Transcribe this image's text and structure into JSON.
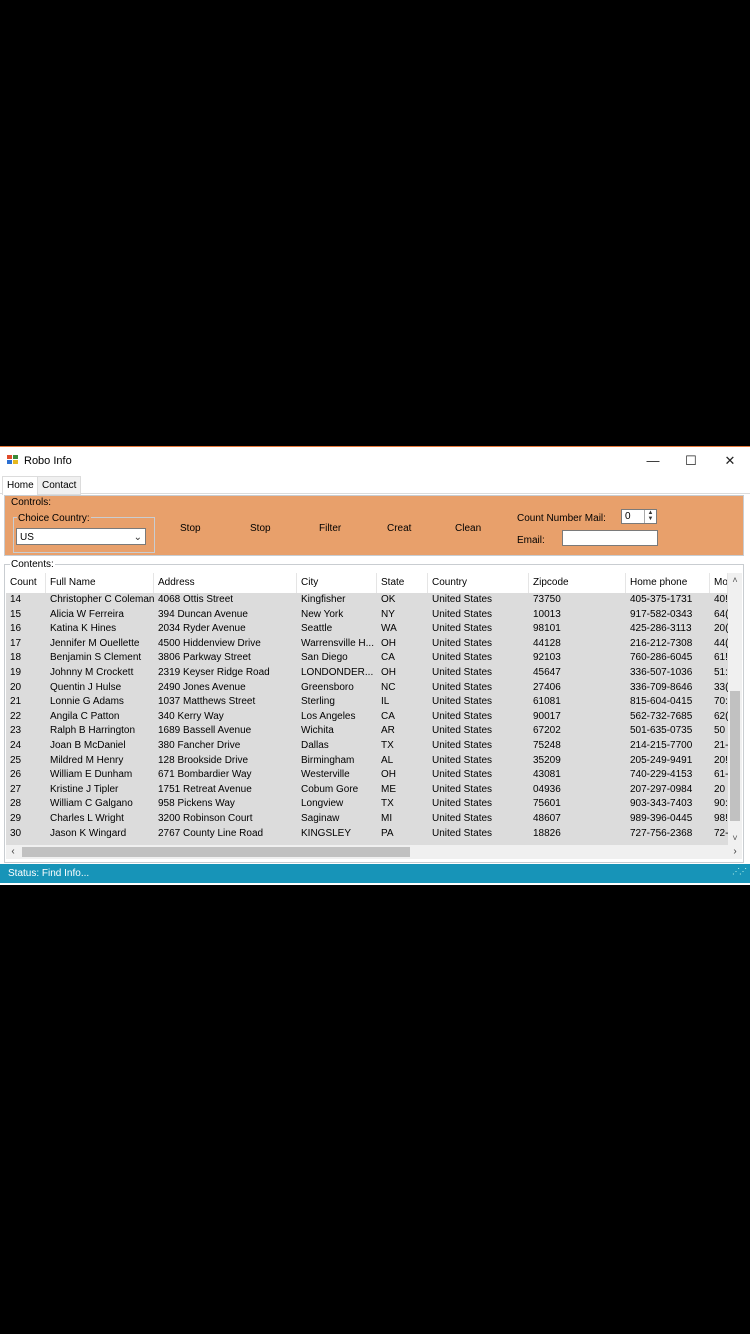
{
  "window": {
    "title": "Robo Info",
    "minimize": "—",
    "maximize": "☐",
    "close": "✕"
  },
  "tabs": {
    "home": "Home",
    "contact": "Contact"
  },
  "controls": {
    "group_label": "Controls:",
    "choice_label": "Choice Country:",
    "country_value": "US",
    "buttons": [
      "Stop",
      "Stop",
      "Filter",
      "Creat",
      "Clean"
    ],
    "count_label": "Count Number Mail:",
    "count_value": "0",
    "email_label": "Email:"
  },
  "contents": {
    "label": "Contents:",
    "columns": [
      "Count",
      "Full Name",
      "Address",
      "City",
      "State",
      "Country",
      "Zipcode",
      "Home phone",
      "Mo"
    ],
    "rows": [
      [
        "14",
        "Christopher C Coleman",
        "4068  Ottis Street",
        "Kingfisher",
        "OK",
        "United States",
        "73750",
        "405-375-1731",
        "40!"
      ],
      [
        "15",
        "Alicia W Ferreira",
        "394  Duncan Avenue",
        "New York",
        "NY",
        "United States",
        "10013",
        "917-582-0343",
        "64("
      ],
      [
        "16",
        "Katina K Hines",
        "2034  Ryder Avenue",
        "Seattle",
        "WA",
        "United States",
        "98101",
        "425-286-3113",
        "20("
      ],
      [
        "17",
        "Jennifer M Ouellette",
        "4500  Hiddenview Drive",
        "Warrensville H...",
        "OH",
        "United States",
        "44128",
        "216-212-7308",
        "44("
      ],
      [
        "18",
        "Benjamin S Clement",
        "3806  Parkway Street",
        "San Diego",
        "CA",
        "United States",
        "92103",
        "760-286-6045",
        "61!"
      ],
      [
        "19",
        "Johnny M Crockett",
        "2319  Keyser Ridge Road",
        "LONDONDER...",
        "OH",
        "United States",
        "45647",
        "336-507-1036",
        "51:"
      ],
      [
        "20",
        "Quentin J Hulse",
        "2490  Jones Avenue",
        "Greensboro",
        "NC",
        "United States",
        "27406",
        "336-709-8646",
        "33("
      ],
      [
        "21",
        "Lonnie G Adams",
        "1037  Matthews Street",
        "Sterling",
        "IL",
        "United States",
        "61081",
        "815-604-0415",
        "70:"
      ],
      [
        "22",
        "Angila C Patton",
        "340  Kerry Way",
        "Los Angeles",
        "CA",
        "United States",
        "90017",
        "562-732-7685",
        "62("
      ],
      [
        "23",
        "Ralph B Harrington",
        "1689  Bassell Avenue",
        "Wichita",
        "AR",
        "United States",
        "67202",
        "501-635-0735",
        "50"
      ],
      [
        "24",
        "Joan B McDaniel",
        "380  Fancher Drive",
        "Dallas",
        "TX",
        "United States",
        "75248",
        "214-215-7700",
        "21-"
      ],
      [
        "25",
        "Mildred M Henry",
        "128  Brookside Drive",
        "Birmingham",
        "AL",
        "United States",
        "35209",
        "205-249-9491",
        "20!"
      ],
      [
        "26",
        "William E Dunham",
        "671  Bombardier Way",
        "Westerville",
        "OH",
        "United States",
        "43081",
        "740-229-4153",
        "61-"
      ],
      [
        "27",
        "Kristine J Tipler",
        "1751  Retreat Avenue",
        "Cobum Gore",
        "ME",
        "United States",
        "04936",
        "207-297-0984",
        "20"
      ],
      [
        "28",
        "William C Galgano",
        "958  Pickens Way",
        "Longview",
        "TX",
        "United States",
        "75601",
        "903-343-7403",
        "90:"
      ],
      [
        "29",
        "Charles L Wright",
        "3200  Robinson Court",
        "Saginaw",
        "MI",
        "United States",
        "48607",
        "989-396-0445",
        "98!"
      ],
      [
        "30",
        "Jason K Wingard",
        "2767  County Line Road",
        "KINGSLEY",
        "PA",
        "United States",
        "18826",
        "727-756-2368",
        "72-"
      ]
    ]
  },
  "status": {
    "text": "Status:  Find Info..."
  },
  "colors": {
    "controls_bg": "#e8a06b",
    "status_bg": "#1794b8",
    "grid_bg": "#dcdcdc"
  },
  "icons": {
    "app": "app-icon",
    "dropdown": "chevron-down-icon",
    "stepper": "spinner-arrows-icon"
  }
}
